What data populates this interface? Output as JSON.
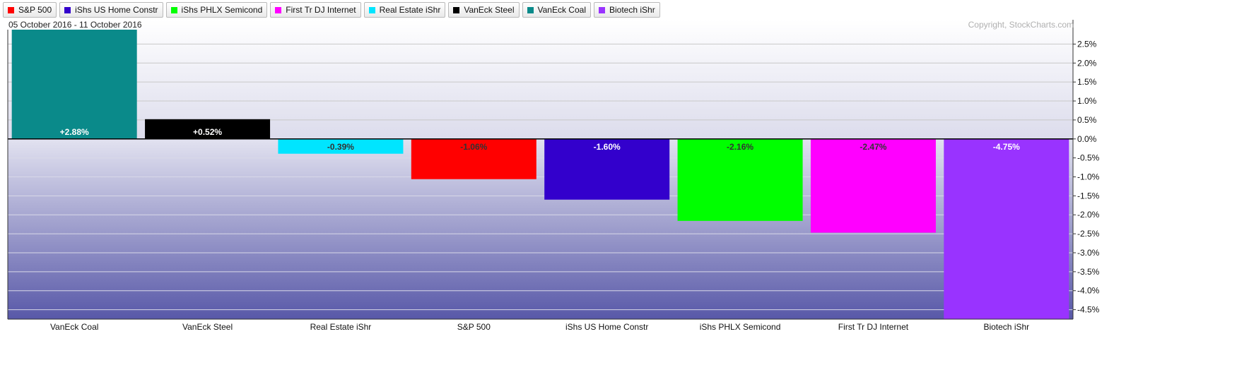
{
  "legend": [
    {
      "label": "S&P 500",
      "color": "#ff0000"
    },
    {
      "label": "iShs US Home Constr",
      "color": "#3300cc"
    },
    {
      "label": "iShs PHLX Semicond",
      "color": "#00ff00"
    },
    {
      "label": "First Tr DJ Internet",
      "color": "#ff00ff"
    },
    {
      "label": "Real Estate iShr",
      "color": "#00e5ff"
    },
    {
      "label": "VanEck Steel",
      "color": "#000000"
    },
    {
      "label": "VanEck Coal",
      "color": "#0a8a8a"
    },
    {
      "label": "Biotech iShr",
      "color": "#9933ff"
    }
  ],
  "date_range": "05 October 2016 - 11 October 2016",
  "copyright": "Copyright, StockCharts.com",
  "chart_data": {
    "type": "bar",
    "categories": [
      "VanEck Coal",
      "VanEck Steel",
      "Real Estate iShr",
      "S&P 500",
      "iShs US Home Constr",
      "iShs PHLX Semicond",
      "First Tr DJ Internet",
      "Biotech iShr"
    ],
    "values": [
      2.88,
      0.52,
      -0.39,
      -1.06,
      -1.6,
      -2.16,
      -2.47,
      -4.75
    ],
    "labels": [
      "+2.88%",
      "+0.52%",
      "-0.39%",
      "-1.06%",
      "-1.60%",
      "-2.16%",
      "-2.47%",
      "-4.75%"
    ],
    "colors": [
      "#0a8a8a",
      "#000000",
      "#00e5ff",
      "#ff0000",
      "#3300cc",
      "#00ff00",
      "#ff00ff",
      "#9933ff"
    ],
    "label_colors": [
      "#ffffff",
      "#ffffff",
      "#333333",
      "#333333",
      "#ffffff",
      "#333333",
      "#333333",
      "#ffffff"
    ],
    "yticks": [
      2.5,
      2.0,
      1.5,
      1.0,
      0.5,
      0.0,
      -0.5,
      -1.0,
      -1.5,
      -2.0,
      -2.5,
      -3.0,
      -3.5,
      -4.0,
      -4.5
    ],
    "ytick_labels": [
      "2.5%",
      "2.0%",
      "1.5%",
      "1.0%",
      "0.5%",
      "0.0%",
      "-0.5%",
      "-1.0%",
      "-1.5%",
      "-2.0%",
      "-2.5%",
      "-3.0%",
      "-3.5%",
      "-4.0%",
      "-4.5%"
    ],
    "ylim": [
      -4.75,
      2.88
    ],
    "grid": true,
    "y_axis_side": "right"
  }
}
